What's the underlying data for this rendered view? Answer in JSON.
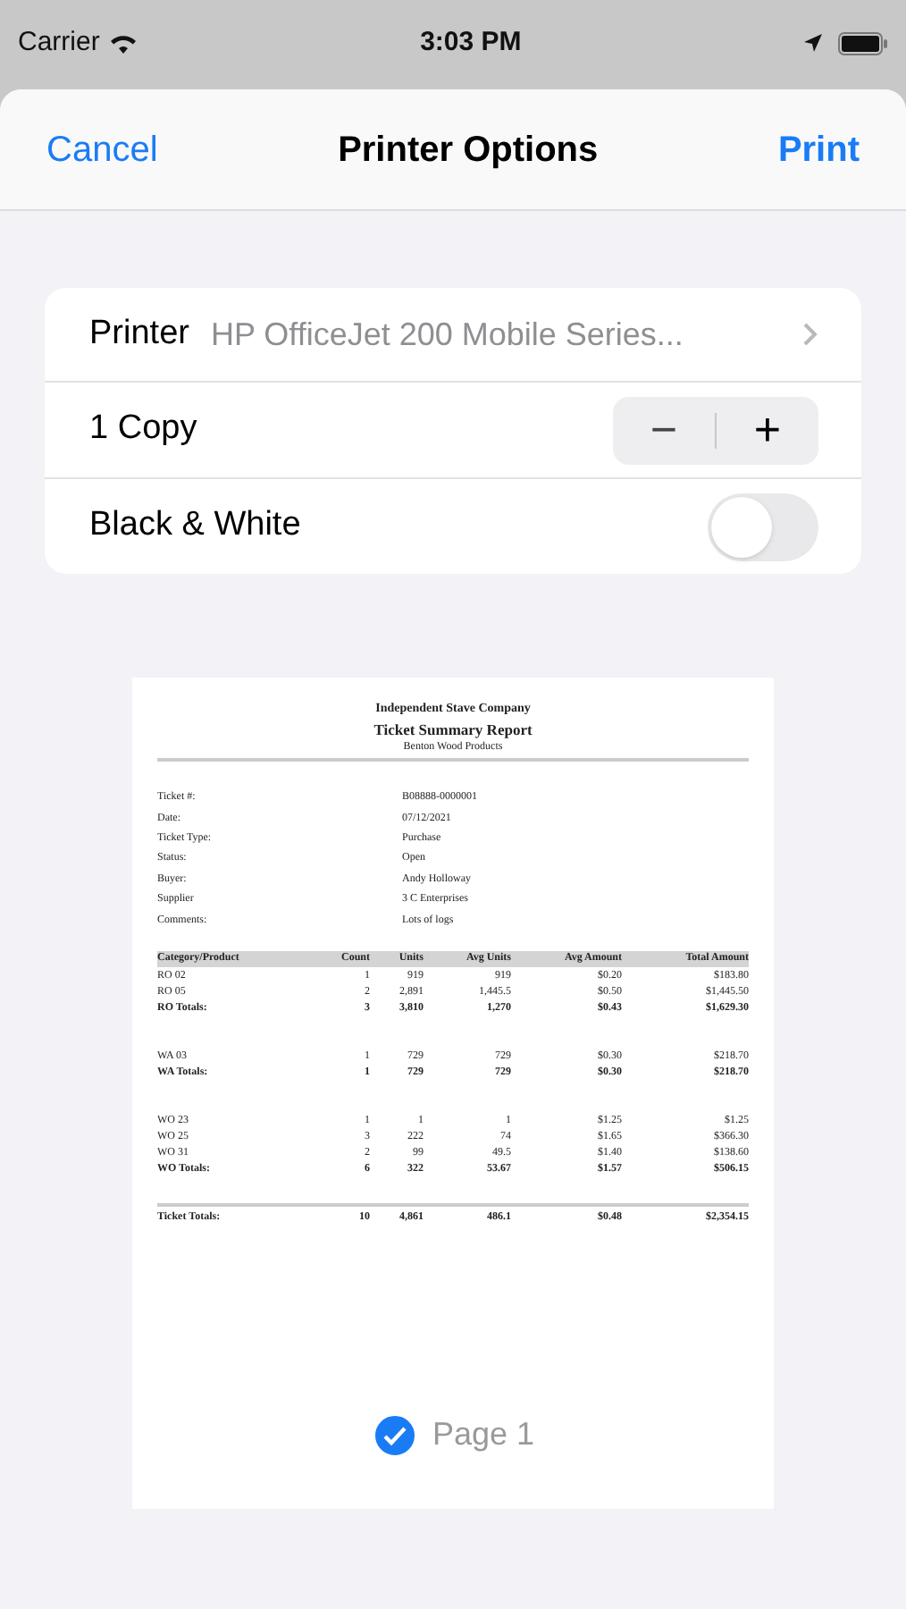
{
  "status_bar": {
    "carrier": "Carrier",
    "time": "3:03 PM"
  },
  "sheet": {
    "cancel": "Cancel",
    "title": "Printer Options",
    "print": "Print"
  },
  "options": {
    "printer_label": "Printer",
    "printer_value": "HP OfficeJet 200 Mobile Series...",
    "copies": "1 Copy",
    "decrement": "−",
    "increment": "+",
    "bw_label": "Black & White",
    "bw_on": false
  },
  "preview": {
    "company": "Independent Stave Company",
    "report_title": "Ticket Summary Report",
    "subtitle": "Benton Wood Products",
    "fields": [
      {
        "label": "Ticket #:",
        "value": "B08888-0000001"
      },
      {
        "label": "Date:",
        "value": "07/12/2021"
      },
      {
        "label": "Ticket Type:",
        "value": "Purchase"
      },
      {
        "label": "Status:",
        "value": "Open"
      },
      {
        "label": "Buyer:",
        "value": "Andy Holloway"
      },
      {
        "label": "Supplier",
        "value": "3 C Enterprises"
      },
      {
        "label": "Comments:",
        "value": "Lots of logs"
      }
    ],
    "columns": [
      "Category/Product",
      "Count",
      "Units",
      "Avg Units",
      "Avg Amount",
      "Total Amount"
    ],
    "groups": [
      {
        "rows": [
          [
            "RO 02",
            "1",
            "919",
            "919",
            "$0.20",
            "$183.80"
          ],
          [
            "RO 05",
            "2",
            "2,891",
            "1,445.5",
            "$0.50",
            "$1,445.50"
          ]
        ],
        "total": [
          "RO Totals:",
          "3",
          "3,810",
          "1,270",
          "$0.43",
          "$1,629.30"
        ]
      },
      {
        "rows": [
          [
            "WA 03",
            "1",
            "729",
            "729",
            "$0.30",
            "$218.70"
          ]
        ],
        "total": [
          "WA Totals:",
          "1",
          "729",
          "729",
          "$0.30",
          "$218.70"
        ]
      },
      {
        "rows": [
          [
            "WO 23",
            "1",
            "1",
            "1",
            "$1.25",
            "$1.25"
          ],
          [
            "WO 25",
            "3",
            "222",
            "74",
            "$1.65",
            "$366.30"
          ],
          [
            "WO 31",
            "2",
            "99",
            "49.5",
            "$1.40",
            "$138.60"
          ]
        ],
        "total": [
          "WO Totals:",
          "6",
          "322",
          "53.67",
          "$1.57",
          "$506.15"
        ]
      }
    ],
    "grand_total": [
      "Ticket Totals:",
      "10",
      "4,861",
      "486.1",
      "$0.48",
      "$2,354.15"
    ],
    "page_label": "Page 1",
    "page_selected": true
  }
}
